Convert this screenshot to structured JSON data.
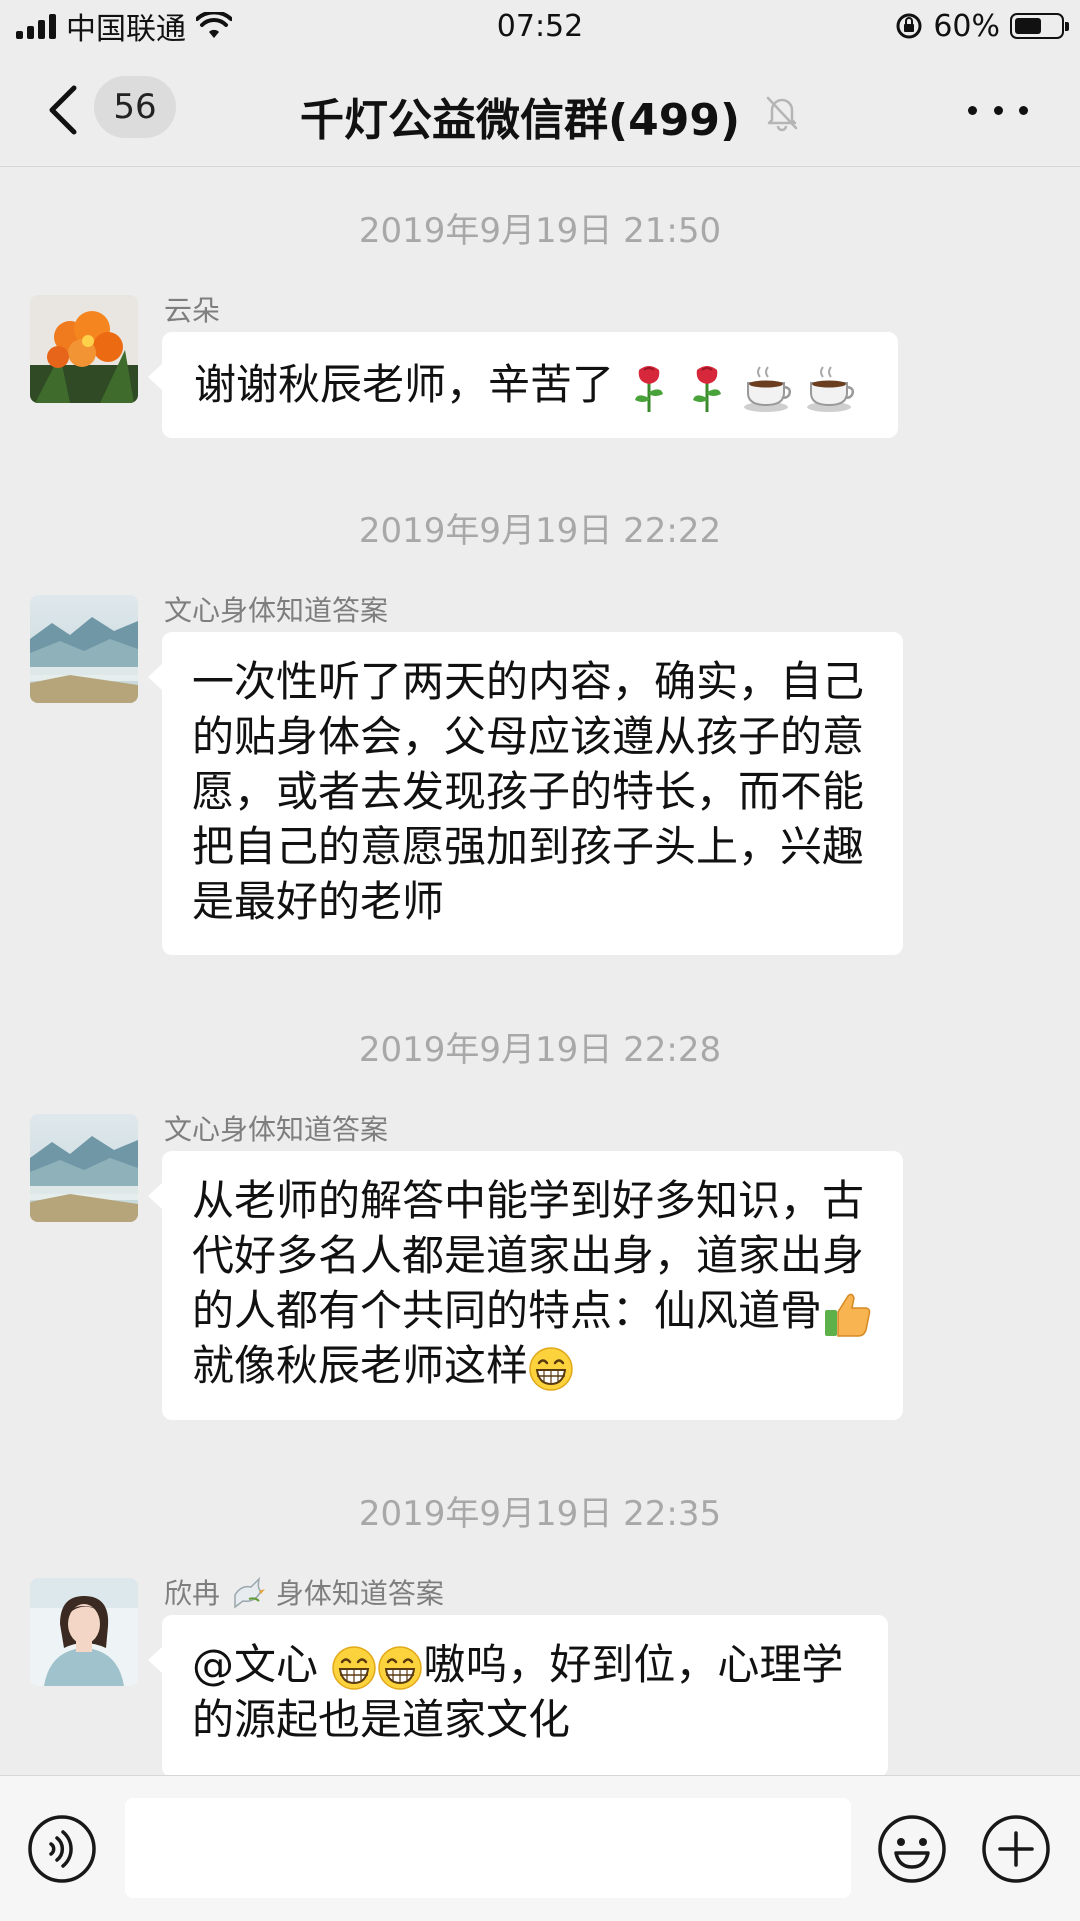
{
  "status_bar": {
    "carrier": "中国联通",
    "time": "07:52",
    "battery": "60%",
    "battery_level": 0.6
  },
  "header": {
    "unread_count": "56",
    "title": "千灯公益微信群(499)"
  },
  "messages": [
    {
      "time": "2019年9月19日 21:50",
      "sender": "云朵",
      "text": "谢谢秋辰老师，辛苦了",
      "emojis": [
        "rose",
        "rose",
        "coffee",
        "coffee"
      ]
    },
    {
      "time": "2019年9月19日 22:22",
      "sender": "文心身体知道答案",
      "text": "一次性听了两天的内容，确实，自己的贴身体会，父母应该遵从孩子的意愿，或者去发现孩子的特长，而不能把自己的意愿强加到孩子头上，兴趣是最好的老师"
    },
    {
      "time": "2019年9月19日 22:28",
      "sender": "文心身体知道答案",
      "text_a": "从老师的解答中能学到好多知识，古代好多名人都是道家出身，道家出身的人都有个共同的特点：仙风道骨",
      "text_b": "就像秋辰老师这样",
      "emojis": [
        "thumbs-up",
        "grin"
      ]
    },
    {
      "time": "2019年9月19日 22:35",
      "sender_a": "欣冉",
      "sender_b": "身体知道答案",
      "sender_emoji": "dove",
      "text_a": "@文心 ",
      "text_b": "嗷呜，好到位，心理学的源起也是道家文化",
      "emojis": [
        "grin",
        "grin"
      ]
    }
  ],
  "input": {
    "placeholder": ""
  }
}
